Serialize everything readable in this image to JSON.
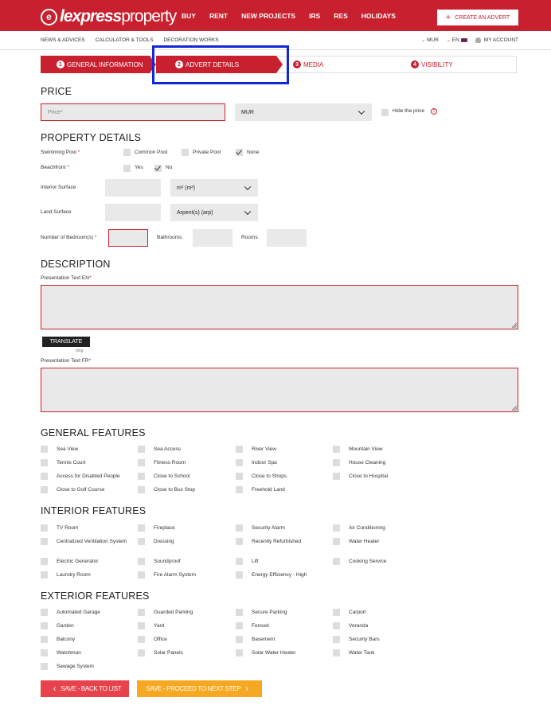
{
  "header": {
    "logo_mark": "e",
    "logo_bold": "lexpress",
    "logo_light": "property",
    "nav": [
      "BUY",
      "RENT",
      "NEW PROJECTS",
      "IRS",
      "RES",
      "HOLIDAYS"
    ],
    "create_advert": "CREATE AN ADVERT"
  },
  "subbar": {
    "links": [
      "NEWS & ADVICES",
      "CALCULATOR & TOOLS",
      "DECORATION WORKS"
    ],
    "currency": "MUR",
    "language": "EN",
    "account": "MY ACCOUNT"
  },
  "steps": [
    {
      "num": "1",
      "label": "GENERAL INFORMATION"
    },
    {
      "num": "2",
      "label": "ADVERT DETAILS"
    },
    {
      "num": "3",
      "label": "MEDIA"
    },
    {
      "num": "4",
      "label": "VISIBILITY"
    }
  ],
  "price": {
    "title": "PRICE",
    "placeholder": "Price*",
    "currency": "MUR",
    "hide_label": "Hide the price",
    "info_icon": "!"
  },
  "property": {
    "title": "PROPERTY DETAILS",
    "pool_label": "Swimming Pool",
    "pool_options": [
      "Common Pool",
      "Private Pool",
      "None"
    ],
    "beach_label": "Beachfront",
    "beach_options": [
      "Yes",
      "No"
    ],
    "interior_label": "Interior Surface",
    "interior_unit": "m² (m²)",
    "land_label": "Land Surface",
    "land_unit": "Arpent(s) (arp)",
    "bedrooms_label": "Number of Bedroom(s)",
    "bathrooms_label": "Bathrooms",
    "rooms_label": "Rooms",
    "req": "*"
  },
  "description": {
    "title": "DESCRIPTION",
    "text_en": "Presentation Text EN",
    "translate": "TRANSLATE",
    "bing": "bing",
    "text_fr": "Presentation Text FR",
    "req": "*"
  },
  "general_features": {
    "title": "GENERAL FEATURES",
    "items": [
      "Sea View",
      "Sea Access",
      "River View",
      "Mountain View",
      "Tennis Court",
      "Fitness Room",
      "Indoor Spa",
      "House Cleaning",
      "Access for Disabled People",
      "Close to School",
      "Close to Shops",
      "Close to Hospital",
      "Close to Golf Course",
      "Close to Bus Stop",
      "Freehold Land"
    ]
  },
  "interior_features": {
    "title": "INTERIOR FEATURES",
    "items": [
      "TV Room",
      "Fireplace",
      "Security Alarm",
      "Air Conditioning",
      "Centralized Ventilation System",
      "Dressing",
      "Recently Refurbished",
      "Water Heater",
      "Electric Generator",
      "Soundproof",
      "Lift",
      "Cooking Service",
      "Laundry Room",
      "Fire Alarm System",
      "Energy Efficiency - High"
    ]
  },
  "exterior_features": {
    "title": "EXTERIOR FEATURES",
    "items": [
      "Automated Garage",
      "Guarded Parking",
      "Secure Parking",
      "Carport",
      "Garden",
      "Yard",
      "Fenced",
      "Veranda",
      "Balcony",
      "Office",
      "Basement",
      "Security Bars",
      "Watchman",
      "Solar Panels",
      "Solar Water Heater",
      "Water Tank",
      "Sewage System"
    ]
  },
  "footer": {
    "back": "SAVE - BACK TO LIST",
    "next": "SAVE - PROCEED TO NEXT STEP",
    "left_arrow": "‹",
    "right_arrow": "›"
  },
  "colors": {
    "brand_red": "#c8202f",
    "orange": "#f7a823",
    "highlight_blue": "#1327d6"
  }
}
